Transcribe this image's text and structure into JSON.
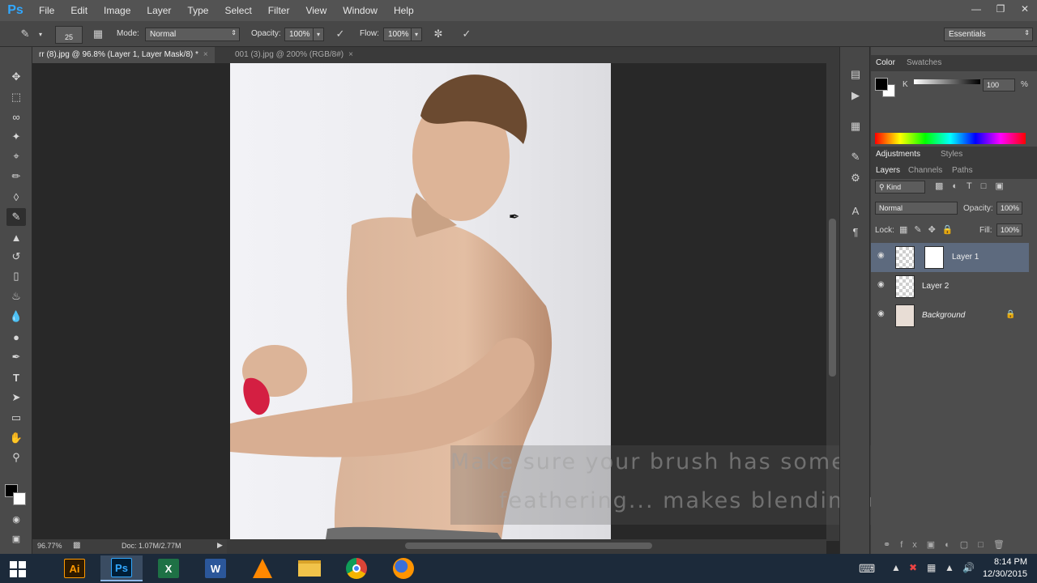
{
  "app": {
    "logo": "Ps"
  },
  "menu": [
    "File",
    "Edit",
    "Image",
    "Layer",
    "Type",
    "Select",
    "Filter",
    "View",
    "Window",
    "Help"
  ],
  "window_controls": [
    "minimize-icon",
    "restore-icon",
    "close-icon"
  ],
  "options_bar": {
    "brush_size": "25",
    "mode_label": "Mode:",
    "mode_value": "Normal",
    "opacity_label": "Opacity:",
    "opacity_value": "100%",
    "flow_label": "Flow:",
    "flow_value": "100%",
    "workspace": "Essentials"
  },
  "tabs": [
    {
      "label": "rr (8).jpg @ 96.8% (Layer 1, Layer Mask/8) *",
      "active": true
    },
    {
      "label": "001 (3).jpg @ 200% (RGB/8#)",
      "active": false
    }
  ],
  "tools": [
    "move-tool",
    "marquee-tool",
    "lasso-tool",
    "magic-wand-tool",
    "crop-tool",
    "eyedropper-tool",
    "healing-tool",
    "brush-tool",
    "clone-stamp-tool",
    "history-brush-tool",
    "eraser-tool",
    "paint-bucket-tool",
    "blur-tool",
    "dodge-tool",
    "pen-tool",
    "type-tool",
    "path-selection-tool",
    "rectangle-tool",
    "hand-tool",
    "zoom-tool"
  ],
  "status": {
    "zoom": "96.77%",
    "doc": "Doc: 1.07M/2.77M"
  },
  "caption": {
    "line1": "Make sure your brush has some",
    "line2": "feathering... makes blending easier"
  },
  "color_panel": {
    "tabs": [
      "Color",
      "Swatches"
    ],
    "channel": "K",
    "value": "100",
    "unit": "%",
    "foreground": "#000000",
    "background": "#ffffff"
  },
  "adjustments_panel": {
    "tabs": [
      "Adjustments",
      "Styles"
    ]
  },
  "layers_panel": {
    "tabs": [
      "Layers",
      "Channels",
      "Paths"
    ],
    "kind_label": "Kind",
    "blend_mode": "Normal",
    "opacity_label": "Opacity:",
    "opacity_value": "100%",
    "lock_label": "Lock:",
    "fill_label": "Fill:",
    "fill_value": "100%",
    "layers": [
      {
        "name": "Layer 1",
        "selected": true,
        "has_mask": true
      },
      {
        "name": "Layer 2",
        "selected": false,
        "has_mask": false
      },
      {
        "name": "Background",
        "selected": false,
        "has_mask": false,
        "locked": true
      }
    ]
  },
  "taskbar": {
    "apps": [
      {
        "name": "Ai",
        "color": "#ff9a00",
        "bg": "#2e1a00"
      },
      {
        "name": "Ps",
        "color": "#31a8ff",
        "bg": "#001e36"
      },
      {
        "name": "X",
        "color": "#ffffff",
        "bg": "#1e7145"
      },
      {
        "name": "W",
        "color": "#ffffff",
        "bg": "#2b579a"
      }
    ],
    "time": "8:14 PM",
    "date": "12/30/2015"
  },
  "colors": {
    "menubar": "#535353",
    "panel": "#4d4d4d",
    "selected_layer": "#5d6a7e",
    "accent": "#31a8ff"
  }
}
